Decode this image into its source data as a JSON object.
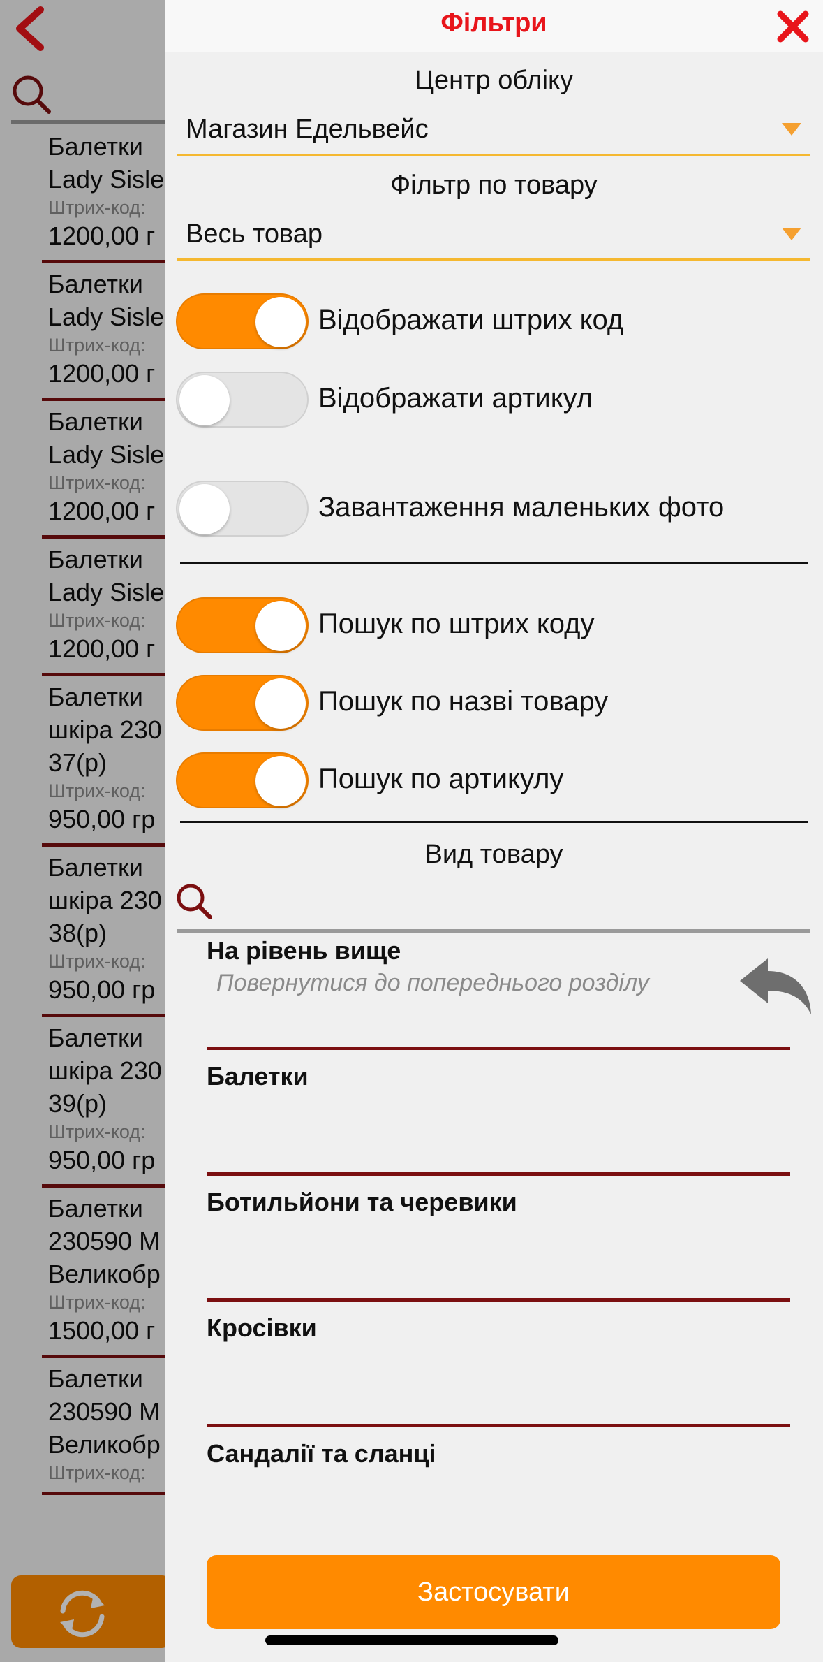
{
  "background": {
    "items": [
      {
        "title1": "Балетки",
        "title2": "Lady Sisle",
        "barcode": "Штрих-код:",
        "price": "1200,00 г"
      },
      {
        "title1": "Балетки",
        "title2": "Lady Sisle",
        "barcode": "Штрих-код:",
        "price": "1200,00 г"
      },
      {
        "title1": "Балетки",
        "title2": "Lady Sisle",
        "barcode": "Штрих-код:",
        "price": "1200,00 г"
      },
      {
        "title1": "Балетки",
        "title2": "Lady Sisle",
        "barcode": "Штрих-код:",
        "price": "1200,00 г"
      },
      {
        "title1": "Балетки",
        "title2": "шкіра 230",
        "title3": "37(р)",
        "barcode": "Штрих-код:",
        "price": "950,00 гр"
      },
      {
        "title1": "Балетки",
        "title2": "шкіра 230",
        "title3": "38(р)",
        "barcode": "Штрих-код:",
        "price": "950,00 гр"
      },
      {
        "title1": "Балетки",
        "title2": "шкіра 230",
        "title3": "39(р)",
        "barcode": "Штрих-код:",
        "price": "950,00 гр"
      },
      {
        "title1": "Балетки",
        "title2": "230590 M",
        "title3": "Великобр",
        "barcode": "Штрих-код:",
        "price": "1500,00 г"
      },
      {
        "title1": "Балетки",
        "title2": "230590 M",
        "title3": "Великобр",
        "barcode": "Штрих-код:",
        "price": ""
      }
    ]
  },
  "panel": {
    "title": "Фільтри",
    "accounting_center": {
      "label": "Центр обліку",
      "value": "Магазин Едельвейс"
    },
    "product_filter": {
      "label": "Фільтр по товару",
      "value": "Весь товар"
    },
    "toggles_display": [
      {
        "label": "Відображати штрих код",
        "on": true
      },
      {
        "label": "Відображати артикул",
        "on": false
      },
      {
        "label": "Завантаження маленьких фото",
        "on": false
      }
    ],
    "toggles_search": [
      {
        "label": "Пошук по штрих коду",
        "on": true
      },
      {
        "label": "Пошук по назві товару",
        "on": true
      },
      {
        "label": "Пошук по артикулу",
        "on": true
      }
    ],
    "product_type": {
      "label": "Вид товару"
    },
    "up_level": {
      "title": "На рівень вище",
      "subtitle": "Повернутися до попереднього розділу"
    },
    "categories": [
      "Балетки",
      "Ботильйони та черевики",
      "Кросівки",
      "Сандалії та сланці"
    ],
    "apply_label": "Застосувати"
  },
  "colors": {
    "accent": "#ff8a00",
    "title_red": "#e8151b",
    "divider_maroon": "#7b0f10",
    "dropdown_underline": "#f5b830"
  }
}
